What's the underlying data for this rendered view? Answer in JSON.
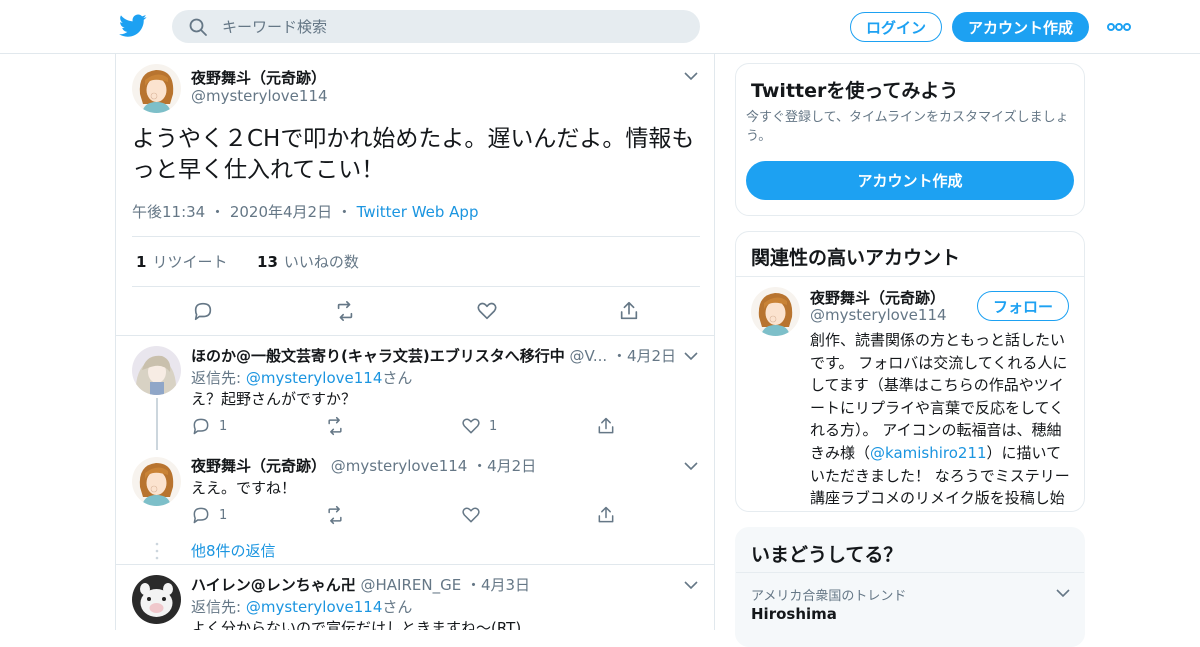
{
  "header": {
    "search_placeholder": "キーワード検索",
    "login_label": "ログイン",
    "signup_label": "アカウント作成"
  },
  "main_tweet": {
    "name": "夜野舞斗（元奇跡）",
    "handle": "@mysterylove114",
    "text": "ようやく２CHで叩かれ始めたよ。遅いんだよ。情報もっと早く仕入れてこい！",
    "time": "午後11:34",
    "date": "2020年4月2日",
    "source": "Twitter Web App",
    "retweets_count": "1",
    "retweets_label": "リツイート",
    "likes_count": "13",
    "likes_label": "いいねの数"
  },
  "replies": [
    {
      "name": "ほのか@一般文芸寄り(キャラ文芸)エブリスタへ移行中",
      "handle": "@V...",
      "date": "4月2日",
      "reply_prefix": "返信先: ",
      "reply_to": "@mysterylove114",
      "reply_suffix": "さん",
      "text": "え？起野さんがですか？",
      "reply_count": "1",
      "like_count": "1"
    },
    {
      "name": "夜野舞斗（元奇跡）",
      "handle": "@mysterylove114",
      "date": "4月2日",
      "text": "ええ。ですね！",
      "reply_count": "1"
    },
    {
      "name": "ハイレン@レンちゃん卍",
      "handle": "@HAIREN_GE",
      "date": "4月3日",
      "reply_prefix": "返信先: ",
      "reply_to": "@mysterylove114",
      "reply_suffix": "さん",
      "text": "よく分からないので宣伝だけしときますね〜(RT)"
    }
  ],
  "more_replies": "他8件の返信",
  "sidebar": {
    "signup_card": {
      "title": "Twitterを使ってみよう",
      "subtitle": "今すぐ登録して、タイムラインをカスタマイズしましょう。",
      "button": "アカウント作成"
    },
    "related_card": {
      "title": "関連性の高いアカウント",
      "name": "夜野舞斗（元奇跡）",
      "handle": "@mysterylove114",
      "follow": "フォロー",
      "bio_before": "創作、読書関係の方ともっと話したいです。 フォロバは交流してくれる人にしてます（基準はこちらの作品やツイートにリプライや言葉で反応をしてくれる方）。 アイコンの転福音は、穂紬きみ様（",
      "bio_link": "@kamishiro211",
      "bio_after": "）に描いていただきました！ なろうでミステリー講座ラブコメのリメイク版を投稿し始めました！"
    },
    "trends_card": {
      "title": "いまどうしてる？",
      "context": "アメリカ合衆国のトレンド",
      "trend": "Hiroshima"
    }
  },
  "colors": {
    "brand": "#1da1f2",
    "link": "#1b95e0",
    "muted": "#657786"
  }
}
